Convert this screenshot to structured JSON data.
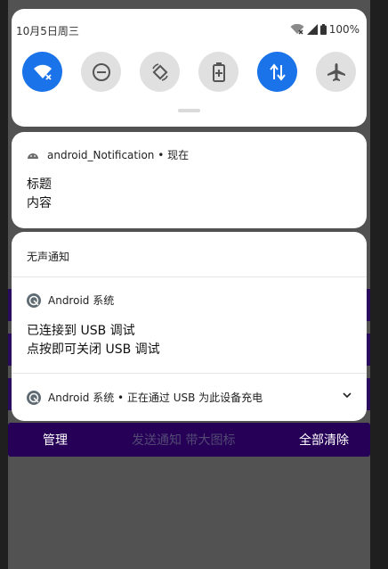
{
  "status_bar": {
    "date": "10月5日周三",
    "battery": "100%"
  },
  "quick_settings": {
    "tiles": [
      {
        "name": "wifi",
        "active": true
      },
      {
        "name": "do-not-disturb",
        "active": false
      },
      {
        "name": "auto-rotate",
        "active": false
      },
      {
        "name": "battery-saver",
        "active": false
      },
      {
        "name": "mobile-data",
        "active": true
      },
      {
        "name": "airplane-mode",
        "active": false
      }
    ]
  },
  "notification": {
    "app_line": "android_Notification • 现在",
    "title": "标题",
    "content": "内容"
  },
  "silent_group": {
    "label": "无声通知",
    "usb_debug": {
      "app": "Android 系统",
      "line1": "已连接到 USB 调试",
      "line2": "点按即可关闭 USB 调试"
    },
    "usb_charging": {
      "text": "Android 系统 • 正在通过 USB 为此设备充电"
    }
  },
  "app_bar": {
    "manage": "管理",
    "send_notification": "发送通知 带大图标",
    "clear_all": "全部清除"
  },
  "colors": {
    "accent": "#1a73e8",
    "app_purple": "#260057",
    "scrim": "#525252"
  }
}
